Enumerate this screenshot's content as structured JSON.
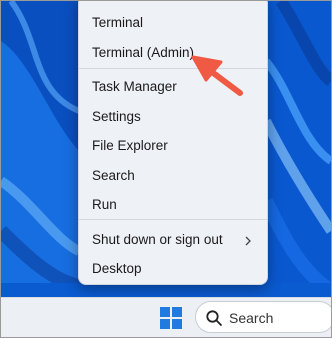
{
  "menu": {
    "items": [
      {
        "label": "Terminal"
      },
      {
        "label": "Terminal (Admin)"
      },
      {
        "label": "Task Manager"
      },
      {
        "label": "Settings"
      },
      {
        "label": "File Explorer"
      },
      {
        "label": "Search"
      },
      {
        "label": "Run"
      },
      {
        "label": "Shut down or sign out",
        "submenu_icon": "chevron-right-icon"
      },
      {
        "label": "Desktop"
      }
    ]
  },
  "taskbar": {
    "start_icon": "windows-logo-icon",
    "search": {
      "icon": "search-icon",
      "placeholder": "Search"
    }
  },
  "annotation": {
    "type": "arrow",
    "color": "#f05a45",
    "points_to": "Terminal (Admin)"
  },
  "colors": {
    "accent": "#1f7be0",
    "wallpaper": "#0a5fd6",
    "menu_bg": "#eef1f6"
  }
}
